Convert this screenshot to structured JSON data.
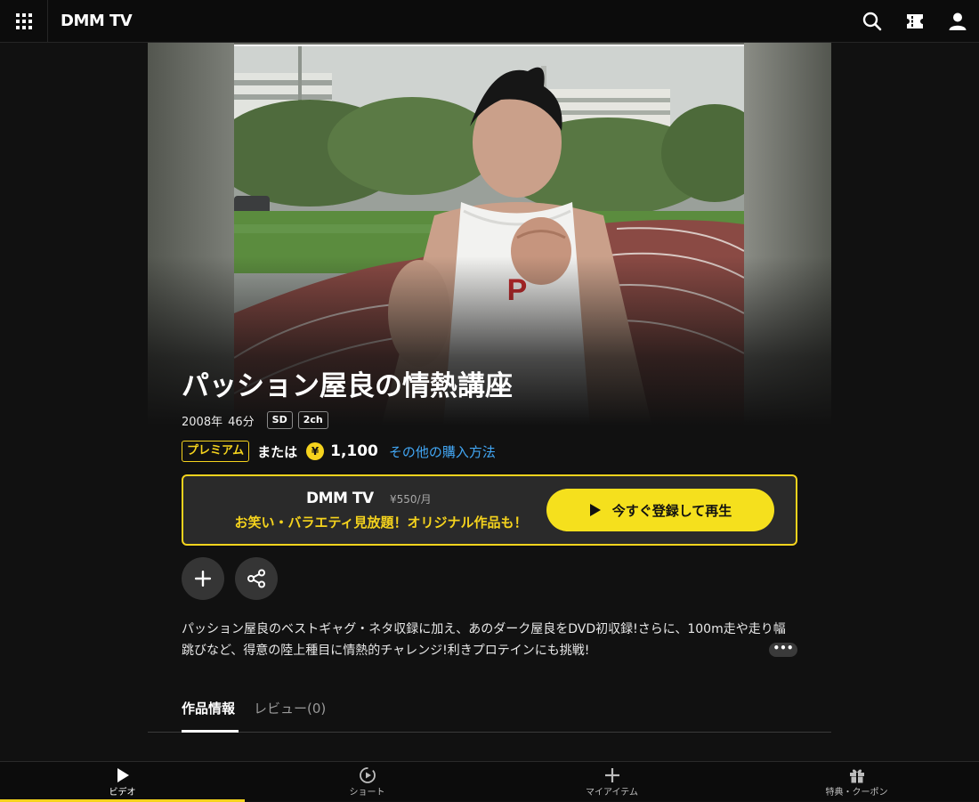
{
  "header": {
    "logo": "DMM TV"
  },
  "title": {
    "text": "パッション屋良の情熱講座",
    "year": "2008年",
    "duration": "46分",
    "badges": [
      "SD",
      "2ch"
    ]
  },
  "price": {
    "premium_tag": "プレミアム",
    "or_text": "または",
    "coin_symbol": "¥",
    "amount": "1,100",
    "other_link": "その他の購入方法"
  },
  "promo": {
    "logo": "DMM TV",
    "monthly_price": "¥550/月",
    "tagline": "お笑い・バラエティ見放題！オリジナル作品も！",
    "cta_label": "今すぐ登録して再生"
  },
  "description": {
    "text": "パッション屋良のベストギャグ・ネタ収録に加え、あのダーク屋良をDVD初収録!さらに、100m走や走り幅跳びなど、得意の陸上種目に情熱的チャレンジ!利きプロテインにも挑戦!",
    "more_label": "•••"
  },
  "tabs": [
    {
      "label": "作品情報",
      "active": true
    },
    {
      "label": "レビュー(0)",
      "active": false
    }
  ],
  "bottom_nav": [
    {
      "label": "ビデオ",
      "icon": "play-icon",
      "active": true
    },
    {
      "label": "ショート",
      "icon": "short-play-icon",
      "active": false
    },
    {
      "label": "マイアイテム",
      "icon": "plus-icon",
      "active": false
    },
    {
      "label": "特典・クーポン",
      "icon": "gift-icon",
      "active": false
    }
  ],
  "colors": {
    "accent": "#f5d31d",
    "link": "#42a7f5",
    "background": "#111111"
  }
}
